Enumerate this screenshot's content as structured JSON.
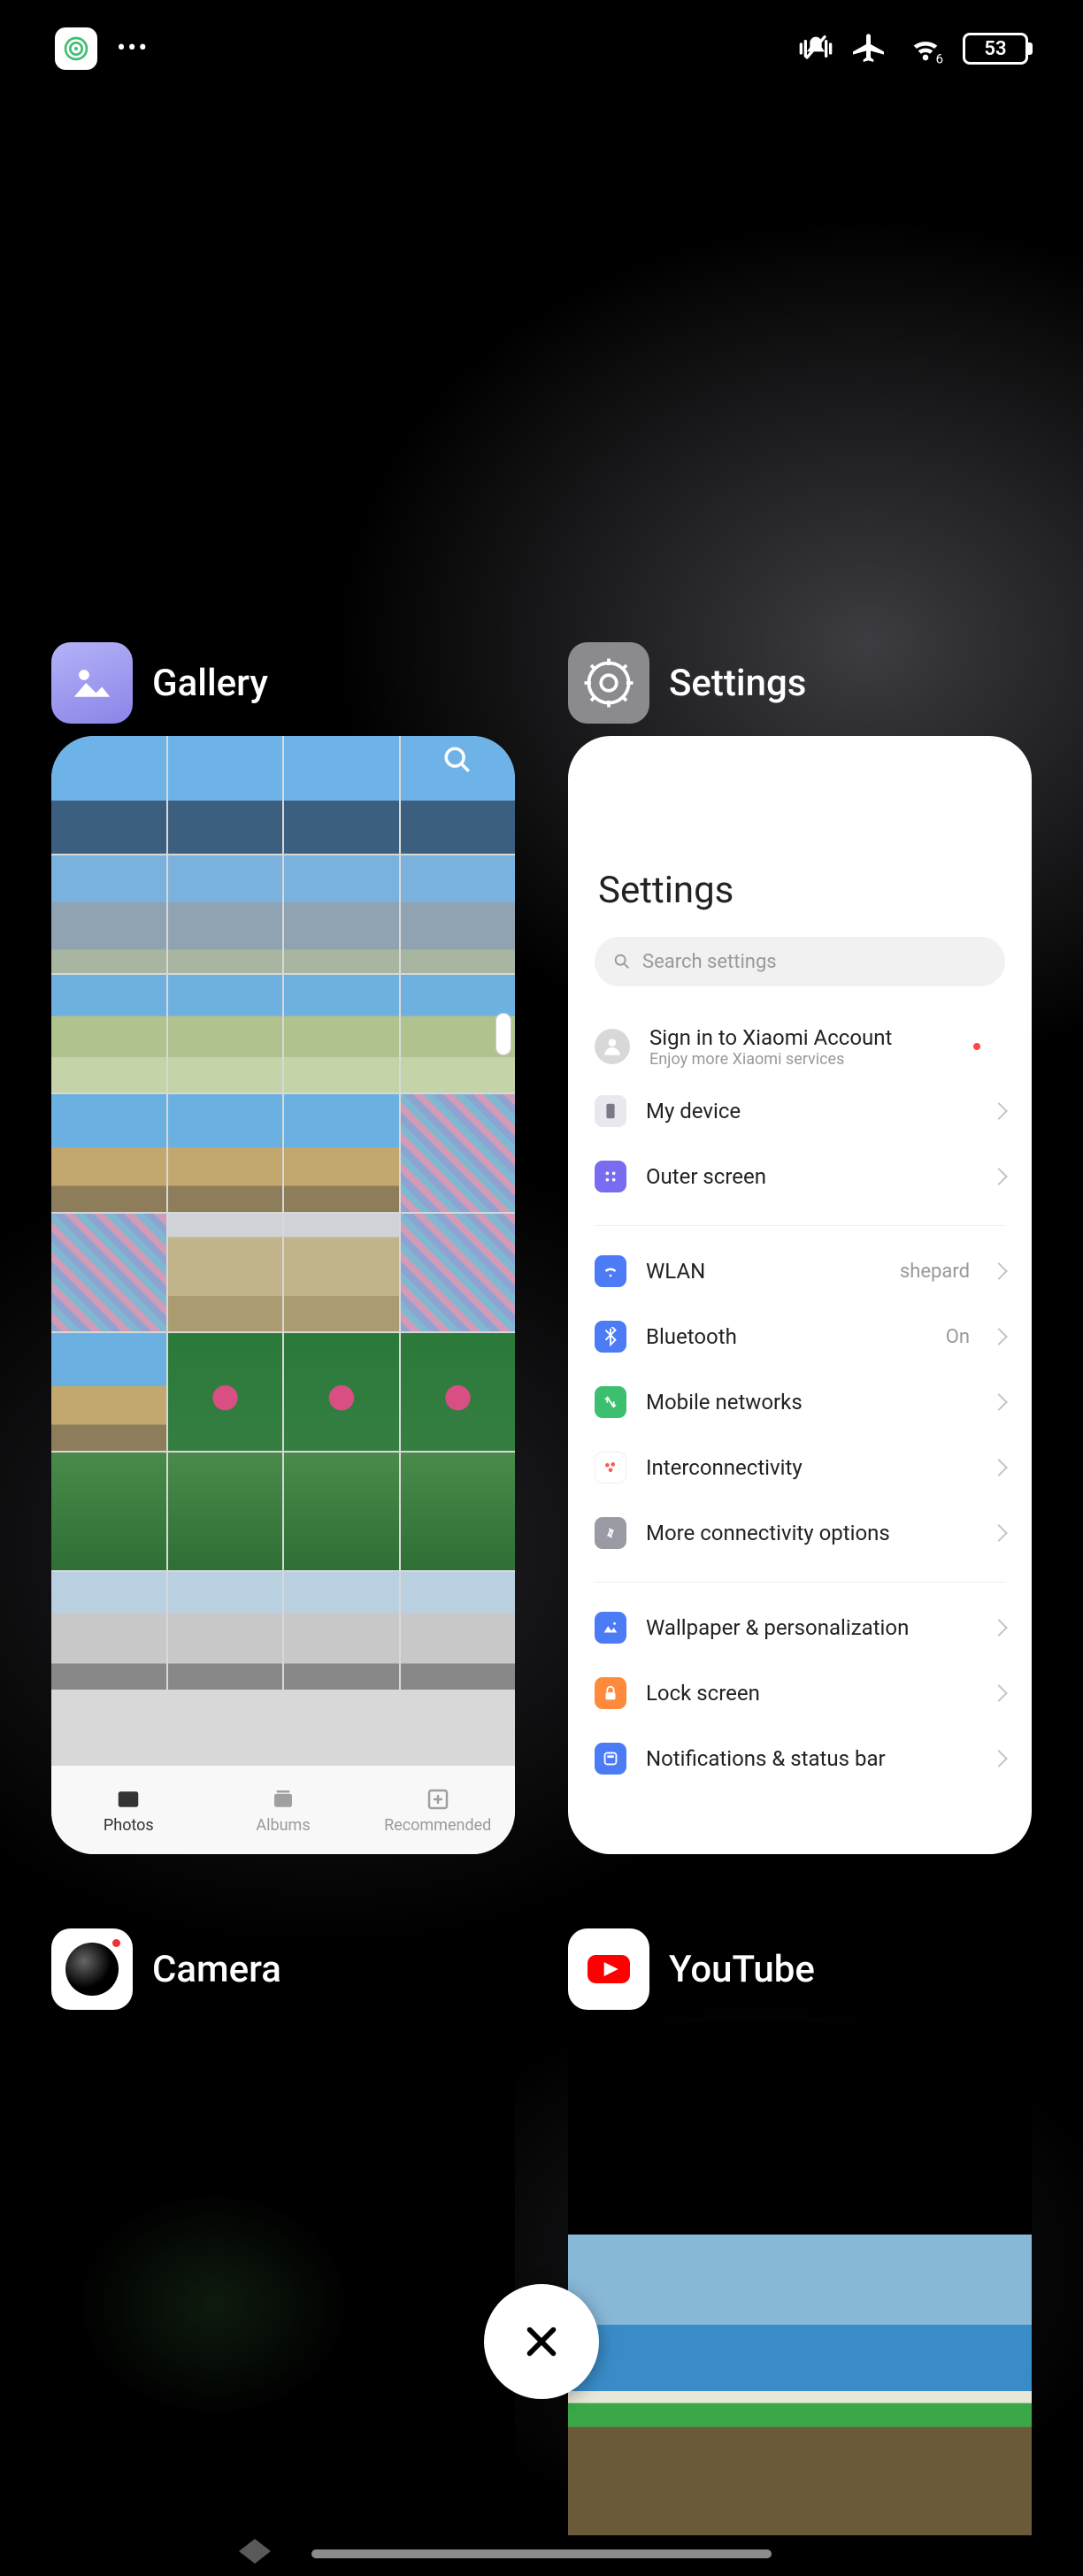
{
  "status_bar": {
    "battery_percent": "53"
  },
  "tasks": {
    "gallery": {
      "title": "Gallery",
      "tabs": {
        "photos": "Photos",
        "albums": "Albums",
        "recommended": "Recommended"
      }
    },
    "settings": {
      "title": "Settings",
      "page_title": "Settings",
      "search_placeholder": "Search settings",
      "account": {
        "title": "Sign in to Xiaomi Account",
        "subtitle": "Enjoy more Xiaomi services"
      },
      "items": {
        "my_device": "My device",
        "outer_screen": "Outer screen",
        "wlan": {
          "label": "WLAN",
          "value": "shepard"
        },
        "bluetooth": {
          "label": "Bluetooth",
          "value": "On"
        },
        "mobile": "Mobile networks",
        "interconnectivity": "Interconnectivity",
        "more_connectivity": "More connectivity options",
        "wallpaper": "Wallpaper & personalization",
        "lock_screen": "Lock screen",
        "notifications": "Notifications & status bar"
      }
    },
    "camera": {
      "title": "Camera"
    },
    "youtube": {
      "title": "YouTube"
    }
  }
}
